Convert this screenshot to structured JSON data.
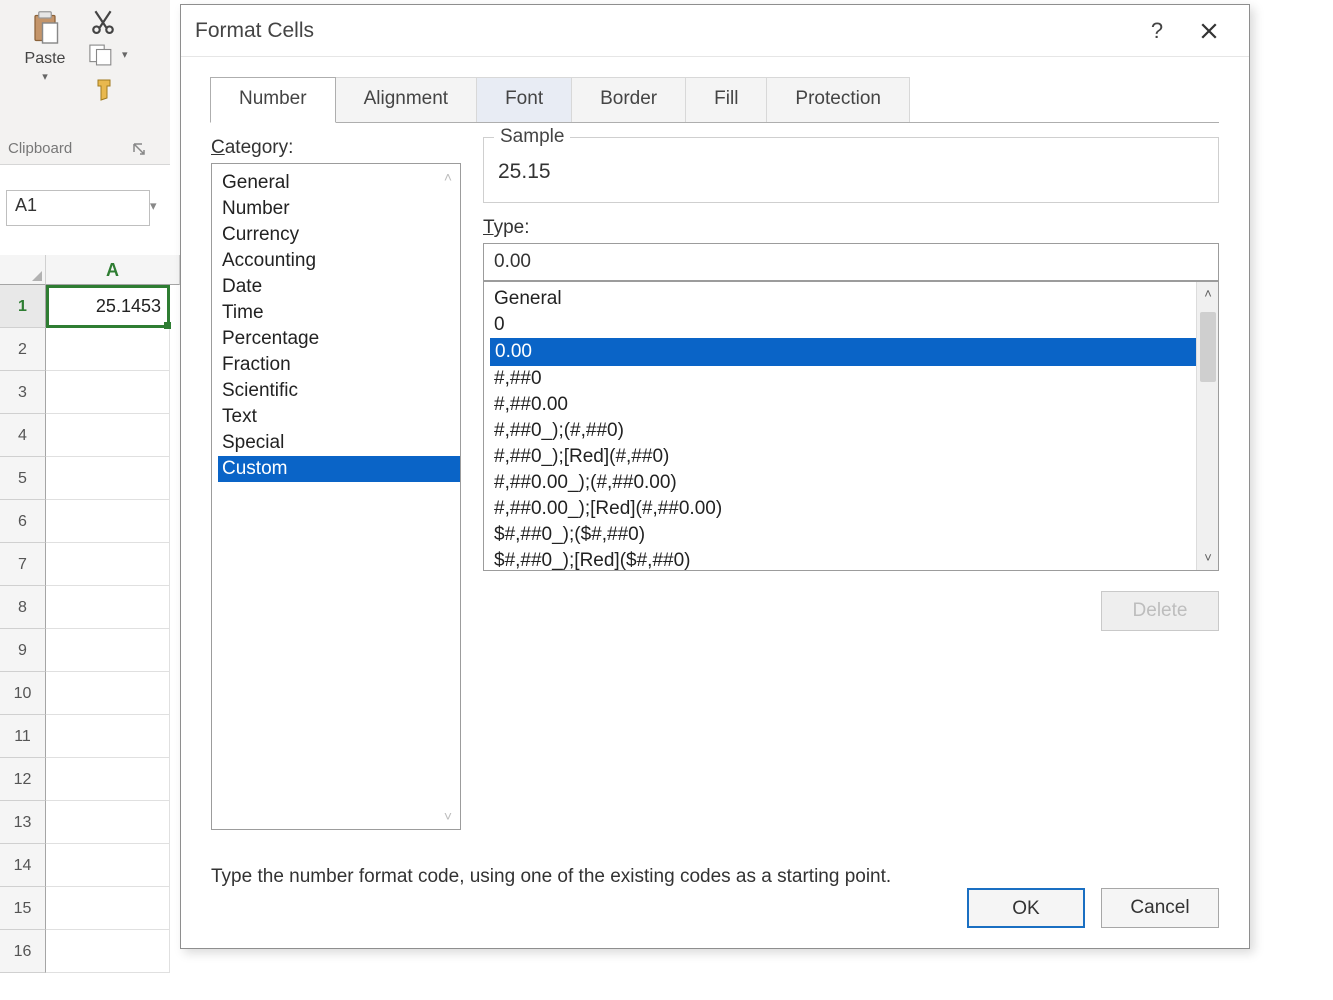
{
  "ribbon": {
    "paste_label": "Paste",
    "clipboard_group_label": "Clipboard"
  },
  "namebox_value": "A1",
  "grid": {
    "col_header": "A",
    "rows": [
      {
        "num": "1",
        "value": "25.1453"
      },
      {
        "num": "2",
        "value": ""
      },
      {
        "num": "3",
        "value": ""
      },
      {
        "num": "4",
        "value": ""
      },
      {
        "num": "5",
        "value": ""
      },
      {
        "num": "6",
        "value": ""
      },
      {
        "num": "7",
        "value": ""
      },
      {
        "num": "8",
        "value": ""
      },
      {
        "num": "9",
        "value": ""
      },
      {
        "num": "10",
        "value": ""
      },
      {
        "num": "11",
        "value": ""
      },
      {
        "num": "12",
        "value": ""
      },
      {
        "num": "13",
        "value": ""
      },
      {
        "num": "14",
        "value": ""
      },
      {
        "num": "15",
        "value": ""
      },
      {
        "num": "16",
        "value": ""
      }
    ]
  },
  "dialog": {
    "title": "Format Cells",
    "tabs": {
      "number": "Number",
      "alignment": "Alignment",
      "font": "Font",
      "border": "Border",
      "fill": "Fill",
      "protection": "Protection"
    },
    "category_label": "Category:",
    "categories": [
      "General",
      "Number",
      "Currency",
      "Accounting",
      "Date",
      "Time",
      "Percentage",
      "Fraction",
      "Scientific",
      "Text",
      "Special",
      "Custom"
    ],
    "category_selected_index": 11,
    "sample_label": "Sample",
    "sample_value": "25.15",
    "type_label": "Type:",
    "type_value": "0.00",
    "type_options": [
      "General",
      "0",
      "0.00",
      "#,##0",
      "#,##0.00",
      "#,##0_);(#,##0)",
      "#,##0_);[Red](#,##0)",
      "#,##0.00_);(#,##0.00)",
      "#,##0.00_);[Red](#,##0.00)",
      "$#,##0_);($#,##0)",
      "$#,##0_);[Red]($#,##0)"
    ],
    "type_selected_index": 2,
    "delete_button": "Delete",
    "explain_text": "Type the number format code, using one of the existing codes as a starting point.",
    "ok_button": "OK",
    "cancel_button": "Cancel"
  }
}
